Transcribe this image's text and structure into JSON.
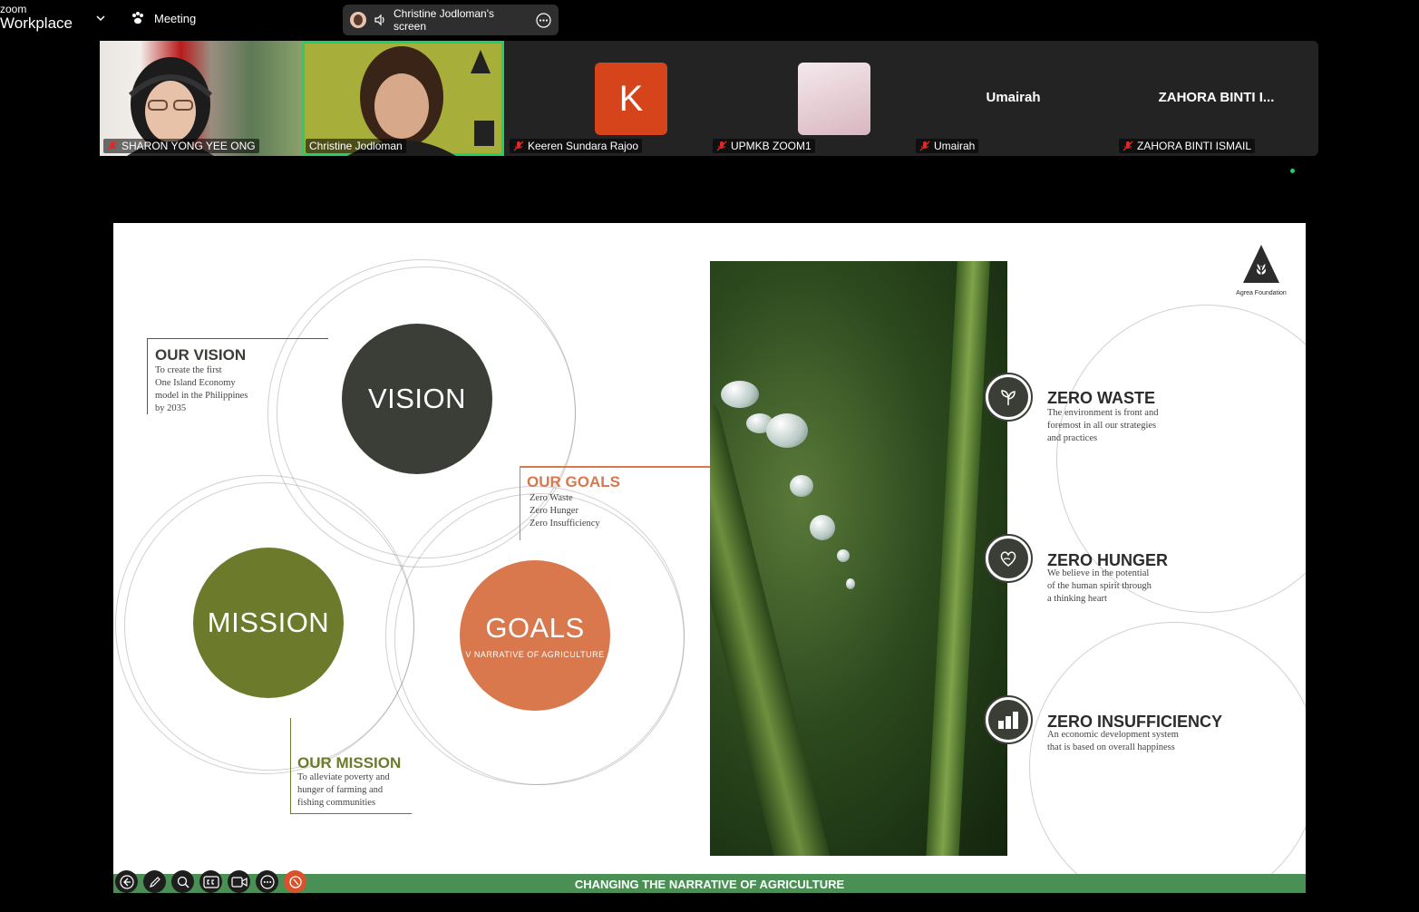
{
  "app": {
    "brand_top": "zoom",
    "brand_bottom": "Workplace",
    "meeting_label": "Meeting"
  },
  "share": {
    "label": "Christine Jodloman's screen"
  },
  "participants": [
    {
      "name": "SHARON YONG YEE ONG"
    },
    {
      "name": "Christine Jodloman"
    },
    {
      "name": "Keeren Sundara Rajoo",
      "initial": "K"
    },
    {
      "name": "UPMKB ZOOM1"
    },
    {
      "name": "Umairah",
      "display": "Umairah"
    },
    {
      "name": "ZAHORA BINTI ISMAIL",
      "display": "ZAHORA BINTI I..."
    }
  ],
  "slide": {
    "logo_caption": "Agrea Foundation",
    "vision_circle": "VISION",
    "mission_circle": "MISSION",
    "goals_circle": "GOALS",
    "goals_sub": "V NARRATIVE OF AGRICULTURE",
    "vision": {
      "title": "OUR VISION",
      "body": [
        "To create the first",
        "One Island Economy",
        "model in the Philippines",
        "by 2035"
      ]
    },
    "goals": {
      "title": "OUR GOALS",
      "body": [
        "Zero Waste",
        "Zero Hunger",
        "Zero Insufficiency"
      ]
    },
    "mission": {
      "title": "OUR MISSION",
      "body": [
        "To alleviate poverty and",
        "hunger of farming and",
        "fishing communities"
      ]
    },
    "zero_waste": {
      "title": "ZERO WASTE",
      "body": [
        "The environment is front and",
        "foremost in all our strategies",
        "and practices"
      ]
    },
    "zero_hunger": {
      "title": "ZERO HUNGER",
      "body": [
        "We believe in the potential",
        "of the human spirit through",
        "a thinking heart"
      ]
    },
    "zero_insufficiency": {
      "title": "ZERO INSUFFICIENCY",
      "body": [
        "An economic development system",
        "that is based on overall happiness"
      ]
    },
    "footer": "CHANGING THE NARRATIVE OF AGRICULTURE"
  },
  "colors": {
    "accent_green": "#1fd16a",
    "vision": "#3b3e36",
    "mission": "#6c7a2c",
    "goals": "#d9774d",
    "footer": "#4a8f54"
  },
  "icons": [
    "chevron-down-icon",
    "paw-icon",
    "speaker-icon",
    "more-icon",
    "mic-off-icon",
    "leaf-icon",
    "heart-hand-icon",
    "bar-chart-icon",
    "back-icon",
    "pen-icon",
    "zoom-icon",
    "cc-icon",
    "camera-icon",
    "ellipsis-icon",
    "stop-icon"
  ]
}
